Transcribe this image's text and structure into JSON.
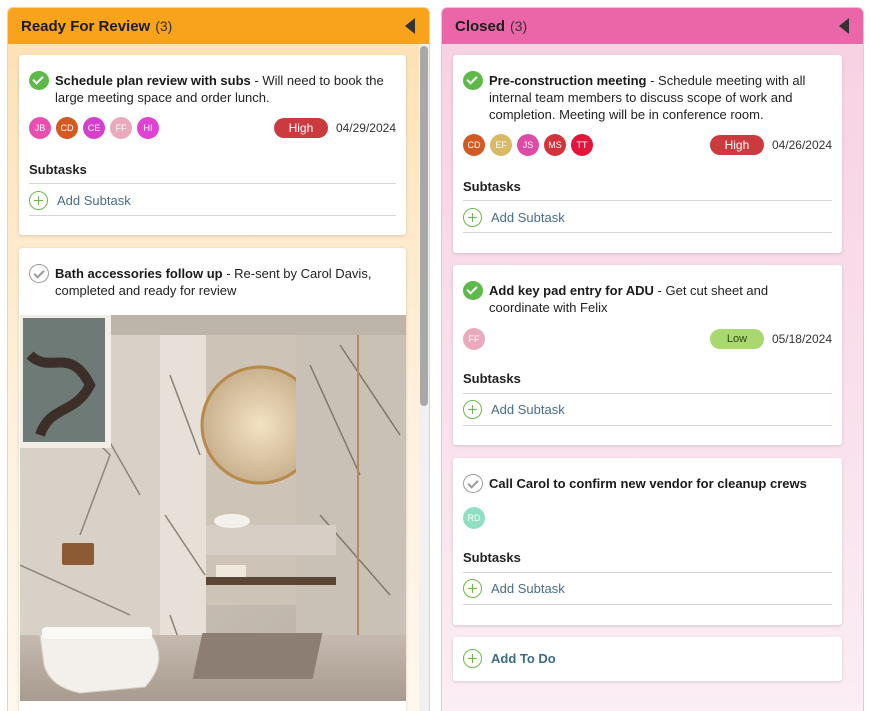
{
  "columns": {
    "review": {
      "title": "Ready For Review",
      "count": "(3)",
      "color": "#f9a21c",
      "cards": [
        {
          "title": "Schedule plan review with subs",
          "description": " - Will need to book the large meeting space and order lunch.",
          "completed": true,
          "assignees": [
            "JB",
            "CD",
            "CE",
            "FF",
            "HI"
          ],
          "priority": "High",
          "date": "04/29/2024",
          "subtasks_label": "Subtasks",
          "add_subtask": "Add Subtask"
        },
        {
          "title": "Bath accessories follow up",
          "description": "  - Re-sent by Carol Davis, completed and ready for review",
          "completed": false,
          "image": "bathroom-photo"
        }
      ]
    },
    "closed": {
      "title": "Closed",
      "count": "(3)",
      "color": "#ea66a8",
      "cards": [
        {
          "title": "Pre-construction meeting",
          "description": " - Schedule meeting with all internal team members to discuss scope of work and completion. Meeting will be in conference room.",
          "completed": true,
          "assignees": [
            "CD",
            "EF",
            "JS",
            "MS",
            "TT"
          ],
          "priority": "High",
          "date": "04/26/2024",
          "subtasks_label": "Subtasks",
          "add_subtask": "Add Subtask"
        },
        {
          "title": "Add key pad entry for ADU",
          "description": " - Get cut sheet and coordinate with Felix",
          "completed": true,
          "assignees": [
            "FF"
          ],
          "priority": "Low",
          "date": "05/18/2024",
          "subtasks_label": "Subtasks",
          "add_subtask": "Add Subtask"
        },
        {
          "title": "Call Carol to confirm new vendor for cleanup crews",
          "description": "",
          "completed": false,
          "assignees": [
            "RD"
          ],
          "subtasks_label": "Subtasks",
          "add_subtask": "Add Subtask"
        }
      ],
      "add_todo": "Add To Do"
    }
  },
  "avatar_colors": {
    "JB": "#e84fae",
    "CD": "#d45a22",
    "CE": "#d43fcd",
    "FF": "#eaa9bd",
    "HI": "#e042d4",
    "EF": "#d9b964",
    "JS": "#de4ba5",
    "MS": "#d3343c",
    "TT": "#e4153d",
    "RD": "#8fe0c3"
  },
  "colors": {
    "high": "#cb3a3f",
    "low": "#a8d86e",
    "check": "#5db948"
  }
}
